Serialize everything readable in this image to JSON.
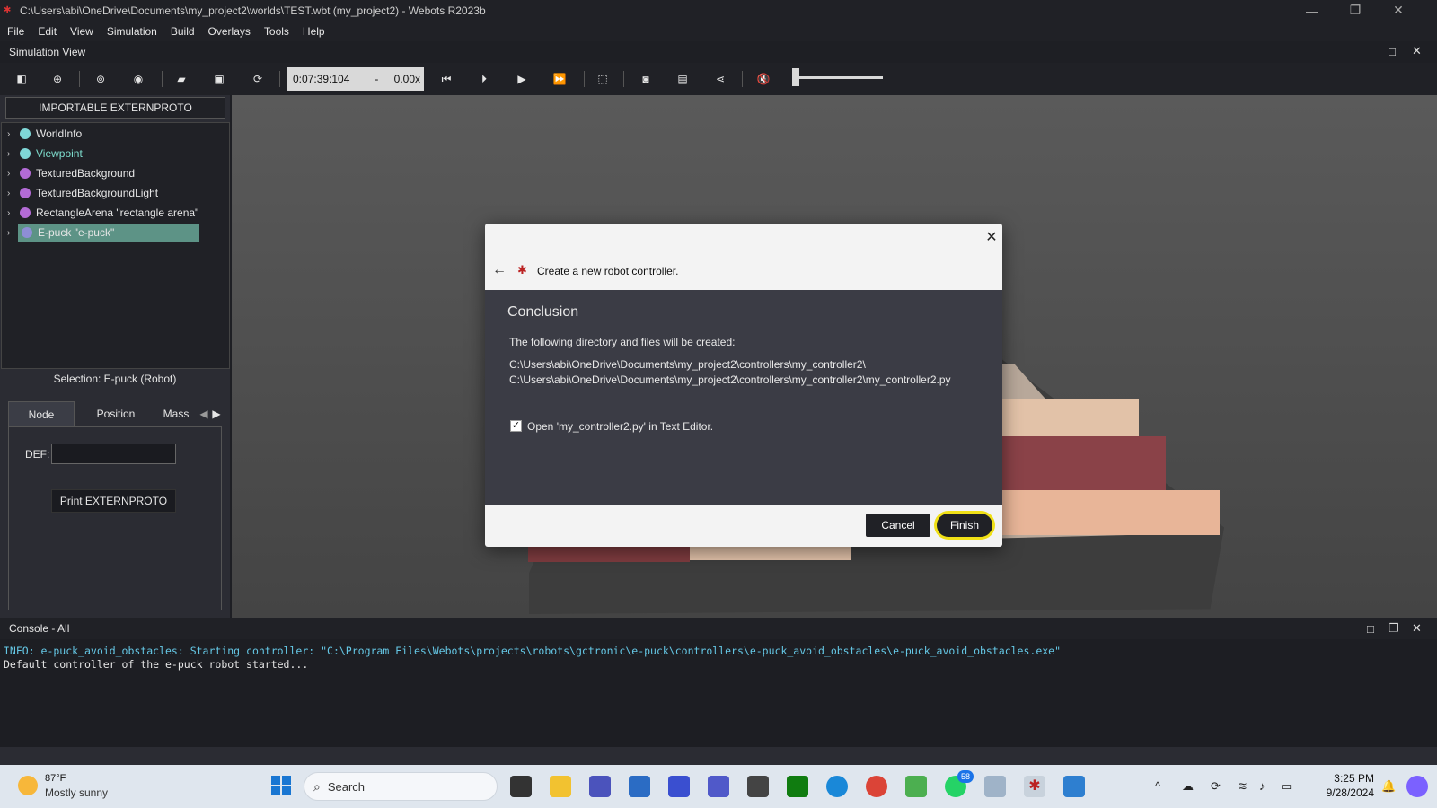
{
  "window": {
    "title": "C:\\Users\\abi\\OneDrive\\Documents\\my_project2\\worlds\\TEST.wbt (my_project2) - Webots R2023b"
  },
  "menu": [
    "File",
    "Edit",
    "View",
    "Simulation",
    "Build",
    "Overlays",
    "Tools",
    "Help"
  ],
  "simulation_view": {
    "label": "Simulation View"
  },
  "toolbar": {
    "time": "0:07:39:104",
    "speed_minus": "-",
    "speed": "0.00x"
  },
  "left_panel": {
    "importable_label": "IMPORTABLE EXTERNPROTO",
    "tree": [
      {
        "label": "WorldInfo",
        "color": "#7fd6d6"
      },
      {
        "label": "Viewpoint",
        "color": "#7fd6d6",
        "text_color": "#7fe0d0"
      },
      {
        "label": "TexturedBackground",
        "color": "#b36bd6"
      },
      {
        "label": "TexturedBackgroundLight",
        "color": "#b36bd6"
      },
      {
        "label": "RectangleArena \"rectangle arena\"",
        "color": "#b36bd6"
      },
      {
        "label": "E-puck \"e-puck\"",
        "color": "#8e8ed6",
        "selected": true
      }
    ],
    "selection_label": "Selection: E-puck (Robot)",
    "tabs": [
      "Node",
      "Position",
      "Mass"
    ],
    "def_label": "DEF:",
    "def_value": "",
    "print_button": "Print EXTERNPROTO"
  },
  "dialog": {
    "title": "Create a new robot controller.",
    "heading": "Conclusion",
    "description": "The following directory and files will be created:",
    "path1": "C:\\Users\\abi\\OneDrive\\Documents\\my_project2\\controllers\\my_controller2\\",
    "path2": "C:\\Users\\abi\\OneDrive\\Documents\\my_project2\\controllers\\my_controller2\\my_controller2.py",
    "checkbox_label": "Open 'my_controller2.py' in Text Editor.",
    "checkbox_checked": true,
    "cancel": "Cancel",
    "finish": "Finish"
  },
  "console": {
    "header": "Console - All",
    "lines": [
      "INFO: e-puck_avoid_obstacles: Starting controller: \"C:\\Program Files\\Webots\\projects\\robots\\gctronic\\e-puck\\controllers\\e-puck_avoid_obstacles\\e-puck_avoid_obstacles.exe\"",
      "Default controller of the e-puck robot started..."
    ]
  },
  "taskbar": {
    "weather_temp": "87°F",
    "weather_desc": "Mostly sunny",
    "search_placeholder": "Search",
    "badge": "58",
    "time": "3:25 PM",
    "date": "9/28/2024"
  }
}
